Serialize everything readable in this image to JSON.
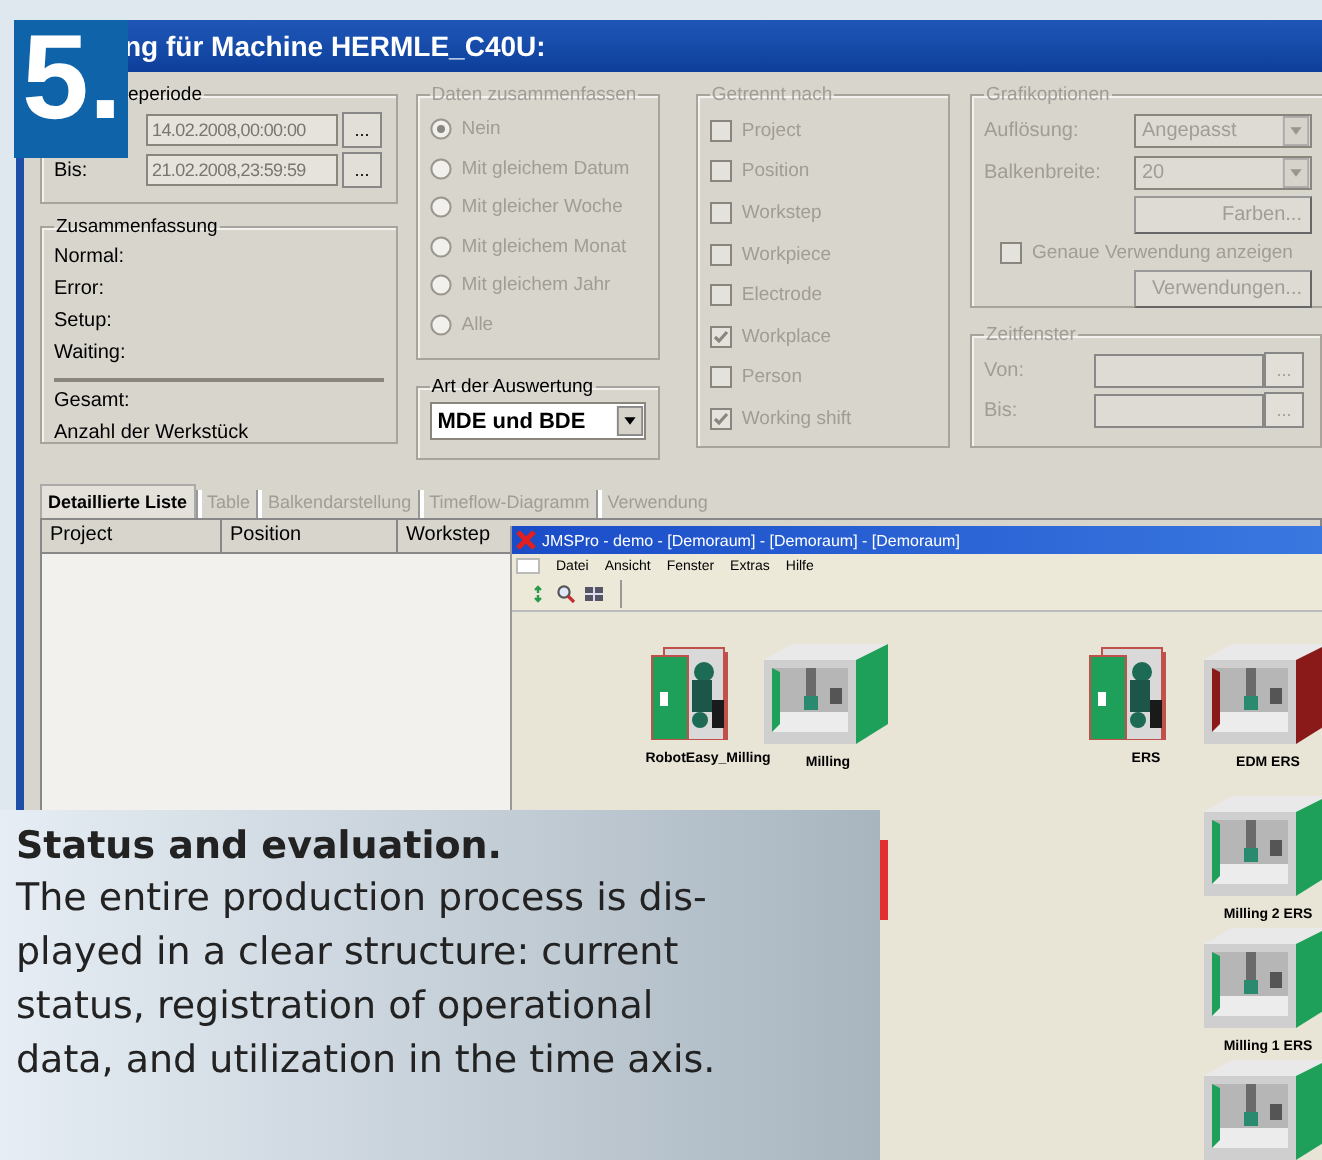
{
  "badge": "5.",
  "window": {
    "title": "ng für Machine HERMLE_C40U:"
  },
  "period": {
    "title": "eperiode",
    "rows": [
      {
        "value": "14.02.2008,00:00:00",
        "button": "..."
      },
      {
        "label": "Bis:",
        "value": "21.02.2008,23:59:59",
        "button": "..."
      }
    ]
  },
  "summary": {
    "title": "Zusammenfassung",
    "rows": [
      "Normal:",
      "Error:",
      "Setup:",
      "Waiting:"
    ],
    "totals": [
      "Gesamt:",
      "Anzahl der Werkstück"
    ]
  },
  "merge": {
    "title": "Daten zusammenfassen",
    "disabled": true,
    "options": [
      {
        "label": "Nein",
        "selected": true
      },
      {
        "label": "Mit gleichem Datum",
        "selected": false
      },
      {
        "label": "Mit gleicher Woche",
        "selected": false
      },
      {
        "label": "Mit gleichem Monat",
        "selected": false
      },
      {
        "label": "Mit gleichem Jahr",
        "selected": false
      },
      {
        "label": "Alle",
        "selected": false
      }
    ]
  },
  "evaluation": {
    "title": "Art der Auswertung",
    "value": "MDE und BDE"
  },
  "split": {
    "title": "Getrennt nach",
    "disabled": true,
    "options": [
      {
        "label": "Project",
        "checked": false
      },
      {
        "label": "Position",
        "checked": false
      },
      {
        "label": "Workstep",
        "checked": false
      },
      {
        "label": "Workpiece",
        "checked": false
      },
      {
        "label": "Electrode",
        "checked": false
      },
      {
        "label": "Workplace",
        "checked": true
      },
      {
        "label": "Person",
        "checked": false
      },
      {
        "label": "Working shift",
        "checked": true
      }
    ]
  },
  "graphics": {
    "title": "Grafikoptionen",
    "disabled": true,
    "fields": [
      {
        "label": "Auflösung:",
        "value": "Angepasst"
      },
      {
        "label": "Balkenbreite:",
        "value": "20"
      }
    ],
    "colors_button": "Farben...",
    "exact": {
      "label": "Genaue Verwendung anzeigen",
      "checked": false
    },
    "usage_button": "Verwendungen..."
  },
  "time_window": {
    "title": "Zeitfenster",
    "disabled": true,
    "fields": [
      {
        "label": "Von:",
        "button": "..."
      },
      {
        "label": "Bis:",
        "button": "..."
      }
    ]
  },
  "tabs": [
    {
      "label": "Detaillierte Liste",
      "selected": true,
      "disabled": false
    },
    {
      "label": "Table",
      "selected": false,
      "disabled": true
    },
    {
      "label": "Balkendarstellung",
      "selected": false,
      "disabled": true
    },
    {
      "label": "Timeflow-Diagramm",
      "selected": false,
      "disabled": true
    },
    {
      "label": "Verwendung",
      "selected": false,
      "disabled": true
    }
  ],
  "table": {
    "columns": [
      "Project",
      "Position",
      "Workstep"
    ]
  },
  "jms_window": {
    "title": "JMSPro - demo - [Demoraum] - [Demoraum] - [Demoraum]",
    "menu": [
      "Datei",
      "Ansicht",
      "Fenster",
      "Extras",
      "Hilfe"
    ],
    "machines": [
      {
        "kind": "robot",
        "label": "RobotEasy_Milling",
        "color": "#1fa05a"
      },
      {
        "kind": "mill",
        "label": "Milling",
        "color": "#1fa05a"
      },
      {
        "kind": "robot",
        "label": "ERS",
        "color": "#1fa05a"
      },
      {
        "kind": "mill",
        "label": "EDM ERS",
        "color": "#8a1a1a"
      },
      {
        "kind": "mill",
        "label": "Milling 2 ERS",
        "color": "#1fa05a"
      },
      {
        "kind": "mill",
        "label": "Milling 1 ERS",
        "color": "#1fa05a"
      },
      {
        "kind": "mill",
        "color": "#1fa05a"
      }
    ]
  },
  "caption": {
    "title": "Status and evaluation.",
    "text": "The entire production process is dis-\nplayed in a clear structure: current\nstatus, registration of operational\ndata, and utilization in the time axis."
  }
}
